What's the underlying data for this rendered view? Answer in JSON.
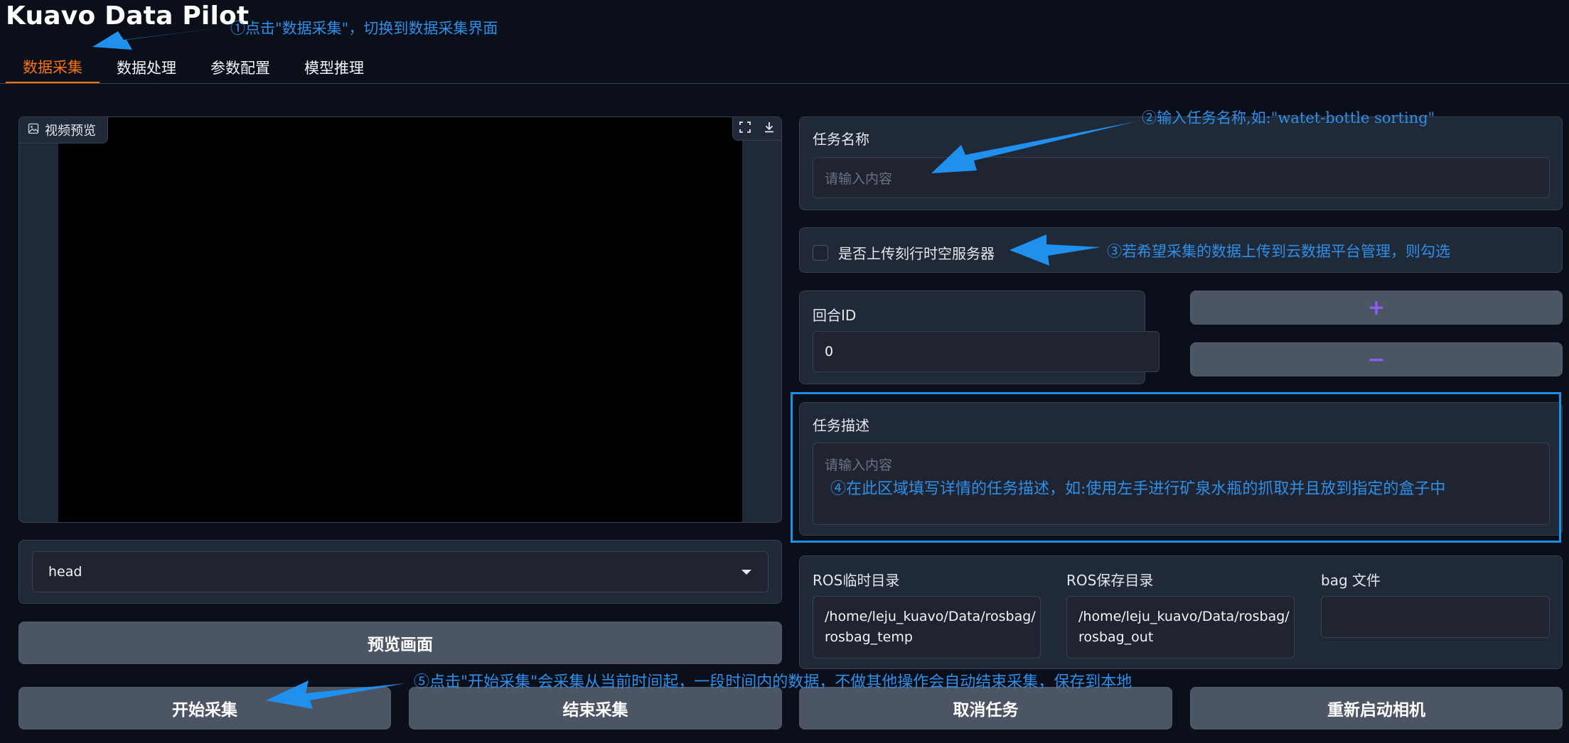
{
  "app": {
    "title": "Kuavo Data Pilot"
  },
  "tabs": [
    {
      "label": "数据采集",
      "active": true
    },
    {
      "label": "数据处理",
      "active": false
    },
    {
      "label": "参数配置",
      "active": false
    },
    {
      "label": "模型推理",
      "active": false
    }
  ],
  "video": {
    "label": "视频预览",
    "icons": [
      "image-icon",
      "fullscreen-icon",
      "download-icon"
    ]
  },
  "camera_select": {
    "value": "head"
  },
  "buttons": {
    "preview": "预览画面",
    "start": "开始采集",
    "stop": "结束采集",
    "cancel": "取消任务",
    "restart_camera": "重新启动相机",
    "increment": "+",
    "decrement": "−"
  },
  "task_name": {
    "label": "任务名称",
    "placeholder": "请输入内容"
  },
  "upload": {
    "label": "是否上传刻行时空服务器",
    "checked": false
  },
  "episode": {
    "label": "回合ID",
    "value": "0"
  },
  "task_desc": {
    "label": "任务描述",
    "placeholder": "请输入内容"
  },
  "ros": {
    "temp_label": "ROS临时目录",
    "temp_value_line1": "/home/leju_kuavo/Data/rosbag/",
    "temp_value_line2": "rosbag_temp",
    "save_label": "ROS保存目录",
    "save_value_line1": "/home/leju_kuavo/Data/rosbag/",
    "save_value_line2": "rosbag_out",
    "bag_label": "bag 文件"
  },
  "annotations": {
    "a1": "①点击\"数据采集\"，切换到数据采集界面",
    "a2": "②输入任务名称,如:\"watet-bottle sorting\"",
    "a3": "③若希望采集的数据上传到云数据平台管理，则勾选",
    "a4": "④在此区域填写详情的任务描述，如:使用左手进行矿泉水瓶的抓取并且放到指定的盒子中",
    "a5": "⑤点击\"开始采集\"会采集从当前时间起，一段时间内的数据，不做其他操作会自动结束采集，保存到本地"
  },
  "colors": {
    "accent": "#f97316",
    "annotation": "#2f8fe8",
    "increment_icon": "#8b5cf6",
    "highlight_border": "#1e90e6"
  }
}
